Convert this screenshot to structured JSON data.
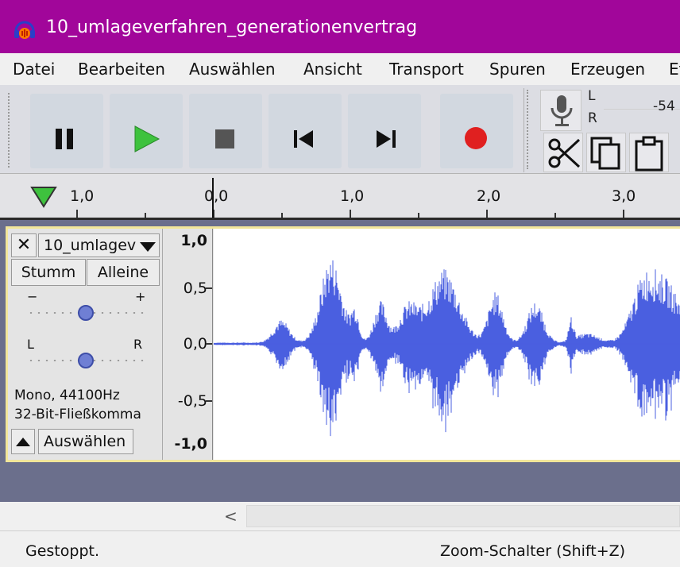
{
  "window": {
    "title": "10_umlageverfahren_generationenvertrag",
    "accent_color": "#a1069a"
  },
  "menu": {
    "items": [
      "Datei",
      "Bearbeiten",
      "Auswählen",
      "Ansicht",
      "Transport",
      "Spuren",
      "Erzeugen",
      "Ef"
    ]
  },
  "toolbar": {
    "buttons": [
      "pause-icon",
      "play-icon",
      "stop-icon",
      "skip-to-start-icon",
      "skip-to-end-icon",
      "record-icon"
    ],
    "meter": {
      "left_label": "L",
      "right_label": "R",
      "value": "-54"
    },
    "edit_icons": [
      "scissors-icon",
      "copy-icon",
      "paste-icon"
    ]
  },
  "ruler": {
    "labels": [
      "1,0",
      "0,0",
      "1,0",
      "2,0",
      "3,0"
    ]
  },
  "track": {
    "close_symbol": "✕",
    "name": "10_umlagev",
    "mute_label": "Stumm",
    "solo_label": "Alleine",
    "gain": {
      "minus": "−",
      "plus": "+"
    },
    "pan": {
      "left": "L",
      "right": "R"
    },
    "info_line1": "Mono, 44100Hz",
    "info_line2": "32-Bit-Fließkomma",
    "select_label": "Auswählen",
    "vruler": [
      "1,0",
      "0,5",
      "0,0",
      "-0,5",
      "-1,0"
    ],
    "wave_color": "#4a5fe0"
  },
  "scroll": {
    "left_arrow": "<"
  },
  "status": {
    "left": "Gestoppt.",
    "right": "Zoom-Schalter (Shift+Z)"
  }
}
